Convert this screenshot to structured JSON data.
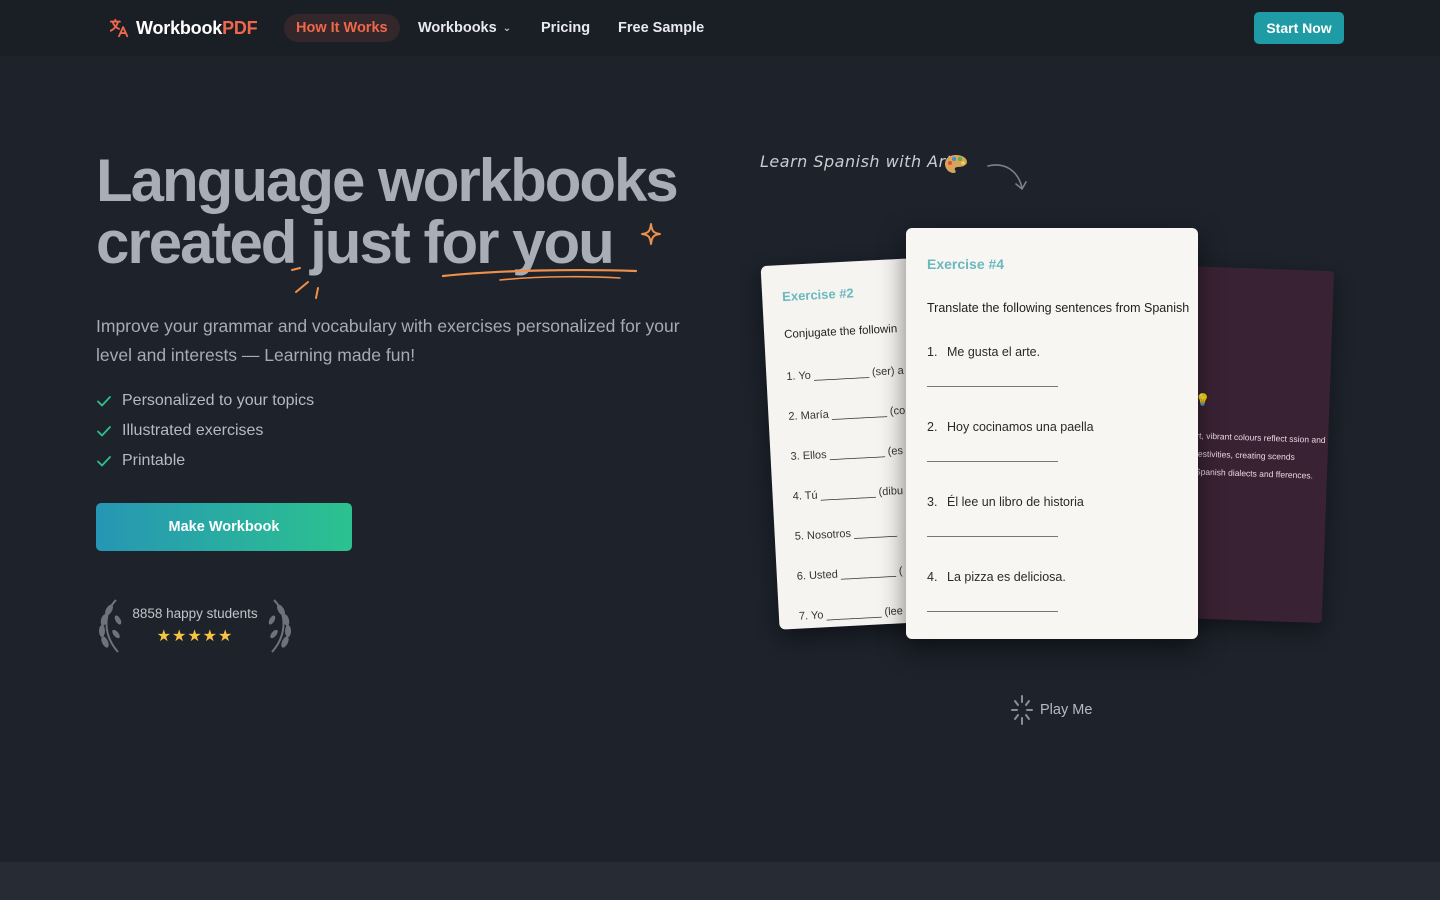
{
  "nav": {
    "brand_part1": "Workbook",
    "brand_part2": "PDF",
    "links": [
      {
        "label": "How It Works"
      },
      {
        "label": "Workbooks"
      },
      {
        "label": "Pricing"
      },
      {
        "label": "Free Sample"
      }
    ],
    "cta": "Start Now"
  },
  "hero": {
    "headline_line1": "Language workbooks",
    "headline_line2": "created just for you",
    "subtitle": "Improve your grammar and vocabulary with exercises personalized for your level and interests — Learning made fun!",
    "features": [
      "Personalized to your topics",
      "Illustrated exercises",
      "Printable"
    ],
    "cta": "Make Workbook",
    "social_proof": "8858 happy students",
    "stars": "★★★★★"
  },
  "showcase": {
    "label": "Learn Spanish with Art",
    "card_mid": {
      "title": "Exercise #2",
      "instruction": "Conjugate the followin",
      "items": [
        "1.  Yo _________ (ser) a",
        "2.  María _________ (co",
        "3.  Ellos _________ (es",
        "4.  Tú _________ (dibu",
        "5.  Nosotros _______",
        "6.  Usted _________ (",
        "7.  Yo _________ (lee"
      ]
    },
    "card_front": {
      "title": "Exercise #4",
      "instruction": "Translate the following sentences from Spanish",
      "items": [
        {
          "num": "1.",
          "text": "Me gusta el arte."
        },
        {
          "num": "2.",
          "text": "Hoy cocinamos una paella"
        },
        {
          "num": "3.",
          "text": "Él lee un libro de historia"
        },
        {
          "num": "4.",
          "text": "La pizza es deliciosa."
        }
      ]
    },
    "card_back_text": "rt, vibrant colours reflect ssion and festivities, creating scends Spanish dialects and fferences.",
    "play_label": "Play Me"
  },
  "colors": {
    "background": "#1d222b",
    "accent_orange": "#f0684b",
    "teal": "#1f9ba6",
    "green": "#2cc28f",
    "star": "#f6c343"
  }
}
